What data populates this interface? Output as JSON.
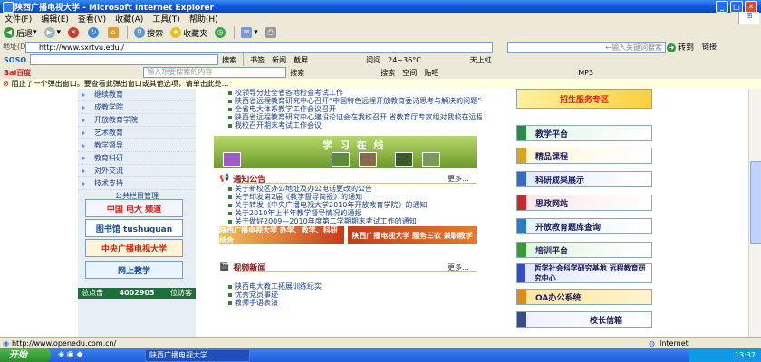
{
  "window": {
    "title": "陕西广播电视大学 - Microsoft Internet Explorer",
    "close_glyph": "✕"
  },
  "menubar": [
    "文件(F)",
    "编辑(E)",
    "查看(V)",
    "收藏(A)",
    "工具(T)",
    "帮助(H)"
  ],
  "toolbar": {
    "back": "后退",
    "search": "搜索",
    "favorites": "收藏夹"
  },
  "address": {
    "label": "地址(D)",
    "url": "http://www.sxrtvu.edu./",
    "search_placeholder": "←输入关键词搜索",
    "go": "转到",
    "links": "链接"
  },
  "sogou": {
    "logo": "SOSO",
    "search_btn": "搜索",
    "items": [
      "书签",
      "新闻",
      "截屏",
      "问问",
      "24~36°C",
      "天上虹"
    ]
  },
  "baidu": {
    "logo": "Bai百度",
    "placeholder": "输入想要搜索的内容",
    "items": [
      "搜索",
      "搜索",
      "空间",
      "贴吧",
      "MP3"
    ]
  },
  "infobar": {
    "text": "阻止了一个弹出窗口。要查看此弹出窗口或其他选项，请单击此处..."
  },
  "leftnav": {
    "items": [
      "继续教育",
      "成教学院",
      "开放教育学院",
      "艺术教育",
      "教学督导",
      "教育科研",
      "对外交流",
      "技术支持"
    ],
    "public_link": "公共栏目管理",
    "banners": [
      "中国 电大 频道",
      "图书馆 tushuguan",
      "中央广播电视大学",
      "网上教学"
    ],
    "stats_label": "总点击",
    "stats_value": "4002905",
    "stats_suffix": "位访客"
  },
  "center": {
    "top_news": [
      "校领导分赴全省各地检查考试工作",
      "陕西省远程教育研究中心召开“中国特色远程开放教育委诗思考与解决的问题”研讨会",
      "全省电大体系教学工作会议召开",
      "陕西省远程教育研究中心建设论证会在我校召开 省教育厅专家组对我校在远程教育研究方面给予肯定",
      "我校召开期末考试工作会议"
    ],
    "flower_title": "学 习 在 线",
    "notice_title": "通知公告",
    "more": "更多...",
    "notices": [
      "关于新校区办公地址及办公电话更改的公告",
      "关于印发第2届《教学督导简报》的通知",
      "关于转发《中央广播电视大学2010年开放教育学院》的通知",
      "关于2010年上半年教学督导情况的通报",
      "关于做好2009—2010年度第二学期期末考试工作的通知"
    ],
    "ad1": "陕西广播电视大学 办学、教学、科研结合",
    "ad2": "陕西广播电视大学 服务三农 兼职教学",
    "video_title": "视频新闻",
    "videos": [
      "陕西电大教工拓展训练纪实",
      "优秀党员事迹",
      "教师手语表演"
    ]
  },
  "right": {
    "items": [
      "教学平台",
      "精品课程",
      "科研成果展示",
      "思政网站",
      "开放教育题库查询",
      "培训平台",
      "哲学社会科学研究基地 远程教育研究中心",
      "OA办公系统",
      "校长信箱"
    ],
    "top_banner": "招生服务专区"
  },
  "statusbar": {
    "url": "http://www.openedu.com.cn/",
    "zone": "Internet"
  },
  "taskbar": {
    "start": "开始",
    "task": "陕西广播电视大学 ...",
    "clock": "13:37"
  }
}
